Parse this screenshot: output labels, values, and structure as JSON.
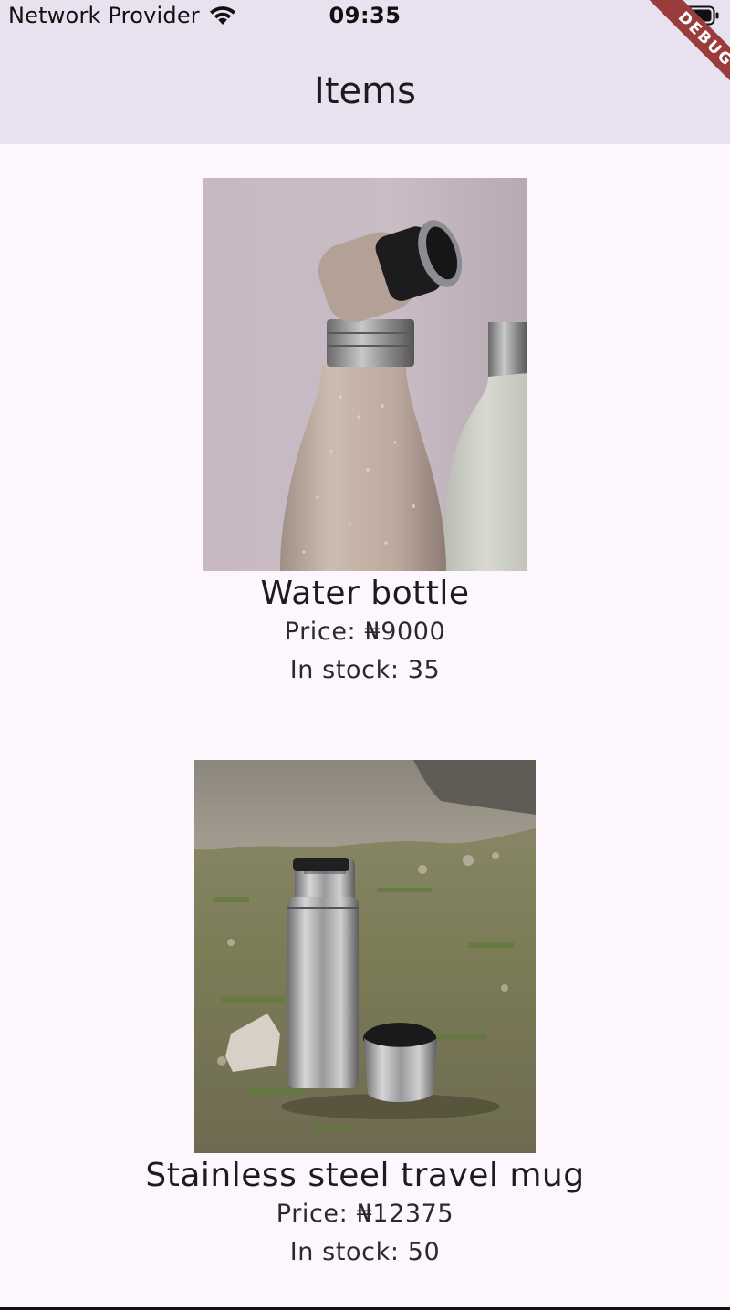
{
  "status_bar": {
    "carrier": "Network Provider",
    "time": "09:35",
    "wifi_icon": "wifi-icon",
    "battery_icon": "battery-full-icon"
  },
  "app_bar": {
    "title": "Items",
    "background": "#e8e1ef"
  },
  "debug_banner": {
    "label": "DEBUG",
    "color": "#9a3b3c"
  },
  "items": [
    {
      "name": "Water bottle",
      "price": "Price: ₦9000",
      "stock": "In stock: 35"
    },
    {
      "name": "Stainless steel travel mug",
      "price": "Price: ₦12375",
      "stock": "In stock: 50"
    }
  ],
  "colors": {
    "page_background": "#fdf7fd",
    "text": "#1d1b20"
  }
}
